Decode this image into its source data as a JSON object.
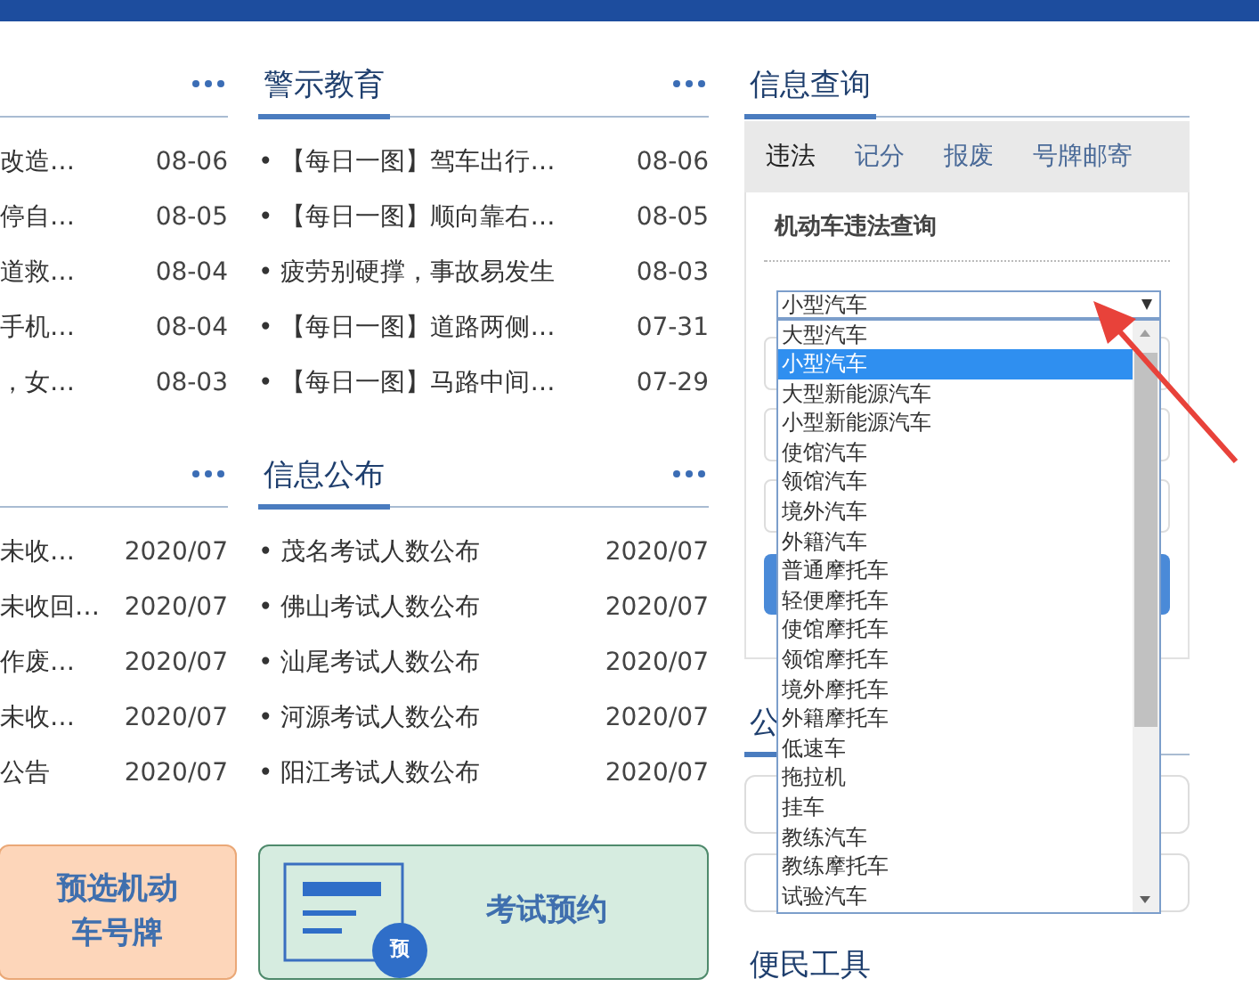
{
  "left_column": {
    "sections": [
      {
        "rows": [
          {
            "title": "改造…",
            "date": "08-06"
          },
          {
            "title": "停自…",
            "date": "08-05"
          },
          {
            "title": "道救…",
            "date": "08-04"
          },
          {
            "title": "手机…",
            "date": "08-04"
          },
          {
            "title": "，女…",
            "date": "08-03"
          }
        ]
      },
      {
        "rows": [
          {
            "title": "未收…",
            "date": "2020/07"
          },
          {
            "title": "未收回…",
            "date": "2020/07"
          },
          {
            "title": "作废…",
            "date": "2020/07"
          },
          {
            "title": "未收…",
            "date": "2020/07"
          },
          {
            "title": "公告",
            "date": "2020/07"
          }
        ]
      }
    ],
    "tile": {
      "lines": [
        "预选机动",
        "车号牌"
      ]
    }
  },
  "middle_column": {
    "sections": [
      {
        "heading": "警示教育",
        "rows": [
          {
            "title": "• 【每日一图】驾车出行…",
            "date": "08-06"
          },
          {
            "title": "• 【每日一图】顺向靠右…",
            "date": "08-05"
          },
          {
            "title": "• 疲劳别硬撑，事故易发生",
            "date": "08-03"
          },
          {
            "title": "• 【每日一图】道路两侧…",
            "date": "07-31"
          },
          {
            "title": "• 【每日一图】马路中间…",
            "date": "07-29"
          }
        ]
      },
      {
        "heading": "信息公布",
        "rows": [
          {
            "title": "• 茂名考试人数公布",
            "date": "2020/07"
          },
          {
            "title": "• 佛山考试人数公布",
            "date": "2020/07"
          },
          {
            "title": "• 汕尾考试人数公布",
            "date": "2020/07"
          },
          {
            "title": "• 河源考试人数公布",
            "date": "2020/07"
          },
          {
            "title": "• 阳江考试人数公布",
            "date": "2020/07"
          }
        ]
      }
    ],
    "tile": {
      "label": "考试预约",
      "badge": "预"
    }
  },
  "info_query": {
    "title": "信息查询",
    "tabs": [
      {
        "label": "违法",
        "selected": true
      },
      {
        "label": "记分",
        "selected": false
      },
      {
        "label": "报废",
        "selected": false
      },
      {
        "label": "号牌邮寄",
        "selected": false
      }
    ],
    "form_title": "机动车违法查询",
    "select": {
      "value": "小型汽车",
      "options": [
        {
          "label": "大型汽车",
          "selected": false
        },
        {
          "label": "小型汽车",
          "selected": true
        },
        {
          "label": "大型新能源汽车",
          "selected": false
        },
        {
          "label": "小型新能源汽车",
          "selected": false
        },
        {
          "label": "使馆汽车",
          "selected": false
        },
        {
          "label": "领馆汽车",
          "selected": false
        },
        {
          "label": "境外汽车",
          "selected": false
        },
        {
          "label": "外籍汽车",
          "selected": false
        },
        {
          "label": "普通摩托车",
          "selected": false
        },
        {
          "label": "轻便摩托车",
          "selected": false
        },
        {
          "label": "使馆摩托车",
          "selected": false
        },
        {
          "label": "领馆摩托车",
          "selected": false
        },
        {
          "label": "境外摩托车",
          "selected": false
        },
        {
          "label": "外籍摩托车",
          "selected": false
        },
        {
          "label": "低速车",
          "selected": false
        },
        {
          "label": "拖拉机",
          "selected": false
        },
        {
          "label": "挂车",
          "selected": false
        },
        {
          "label": "教练汽车",
          "selected": false
        },
        {
          "label": "教练摩托车",
          "selected": false
        },
        {
          "label": "试验汽车",
          "selected": false
        }
      ]
    }
  },
  "notice_heading": "公",
  "tools_heading": "便民工具"
}
